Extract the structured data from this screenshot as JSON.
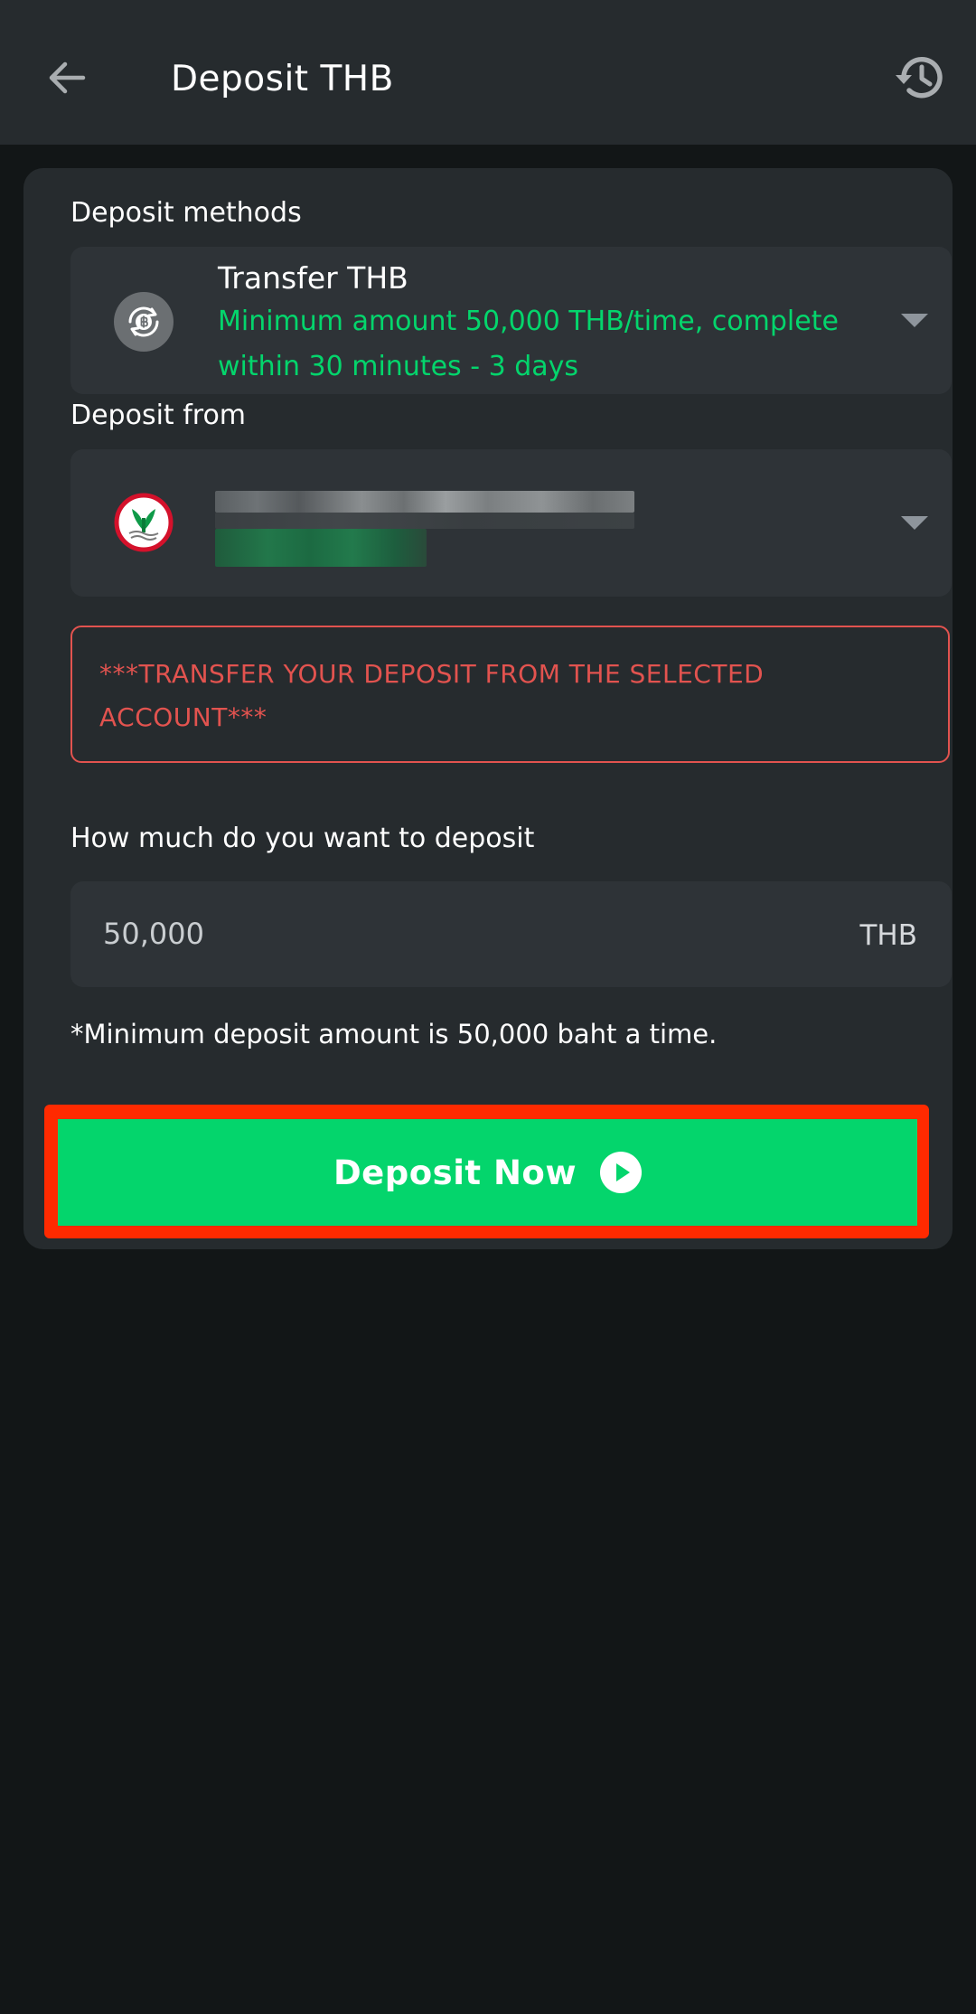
{
  "header": {
    "title": "Deposit THB",
    "back_icon": "arrow-left-icon",
    "history_icon": "history-icon"
  },
  "deposit_method": {
    "label": "Deposit methods",
    "title": "Transfer THB",
    "description": "Minimum amount 50,000 THB/time, complete within 30 minutes - 3 days",
    "icon": "baht-exchange-icon"
  },
  "deposit_from": {
    "label": "Deposit from",
    "bank_icon": "kasikorn-bank-logo"
  },
  "warning": {
    "text": "***TRANSFER YOUR DEPOSIT FROM THE SELECTED ACCOUNT***"
  },
  "amount": {
    "label": "How much do you want to deposit",
    "value": "",
    "placeholder": "50,000",
    "currency": "THB",
    "note": "*Minimum deposit amount is 50,000 baht a time."
  },
  "action": {
    "deposit_label": "Deposit Now",
    "icon": "play-circle-icon"
  },
  "colors": {
    "accent_green": "#04d56c",
    "warning_red": "#e2534f",
    "highlight_outline": "#ff2a00",
    "header_bg": "#262b2e",
    "page_bg": "#121617"
  }
}
